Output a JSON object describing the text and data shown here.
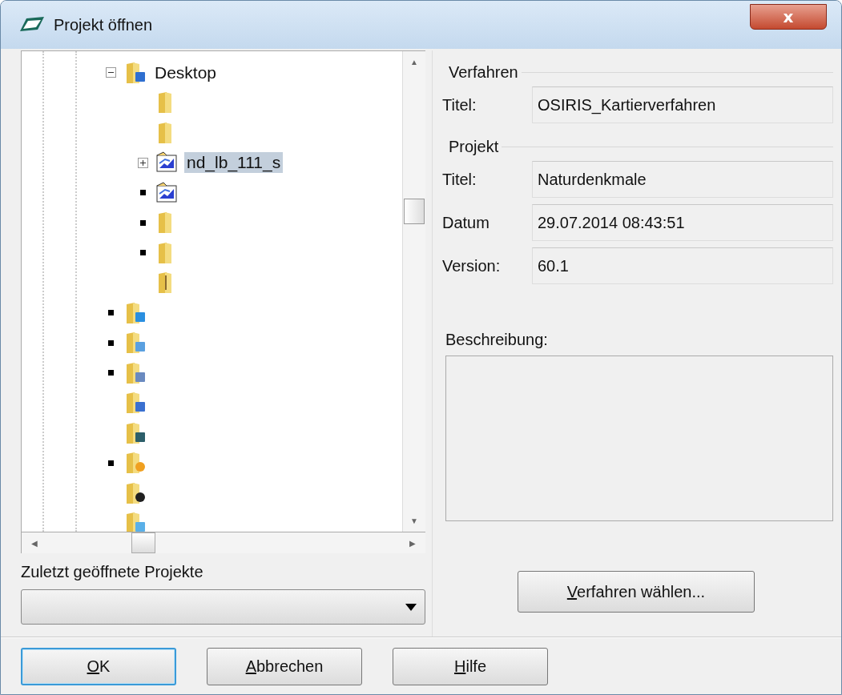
{
  "window": {
    "title": "Projekt öffnen",
    "close": "x"
  },
  "tree": {
    "items": [
      {
        "kind": "desktop",
        "label": "Desktop",
        "expanded": true,
        "selected": false,
        "children": [
          {
            "kind": "folder",
            "selected": false
          },
          {
            "kind": "folder",
            "selected": false
          },
          {
            "kind": "map",
            "label": "nd_lb_111_s",
            "expanded": false,
            "selected": true
          },
          {
            "kind": "map",
            "expanded": false,
            "selected": false
          },
          {
            "kind": "folder",
            "expanded": false,
            "selected": false
          },
          {
            "kind": "folder",
            "expanded": false,
            "selected": false
          },
          {
            "kind": "zip",
            "selected": false
          }
        ]
      },
      {
        "kind": "user",
        "expanded": false,
        "selected": false
      },
      {
        "kind": "doc",
        "expanded": false,
        "selected": false
      },
      {
        "kind": "grid",
        "expanded": false,
        "selected": false
      },
      {
        "kind": "media",
        "selected": false
      },
      {
        "kind": "film",
        "selected": false
      },
      {
        "kind": "star",
        "expanded": false,
        "selected": false
      },
      {
        "kind": "dark",
        "selected": false
      },
      {
        "kind": "image",
        "selected": false
      }
    ],
    "scroll": {
      "up": "▲",
      "down": "▼",
      "left": "◀",
      "right": "▶"
    }
  },
  "recent": {
    "label": "Zuletzt geöffnete Projekte"
  },
  "verfahren": {
    "heading": "Verfahren",
    "fields": [
      {
        "label": "Titel:",
        "value": "OSIRIS_Kartierverfahren"
      }
    ]
  },
  "projekt": {
    "heading": "Projekt",
    "fields": [
      {
        "label": "Titel:",
        "value": "Naturdenkmale"
      },
      {
        "label": "Datum",
        "value": "29.07.2014 08:43:51"
      },
      {
        "label": "Version:",
        "value": "60.1"
      }
    ]
  },
  "beschreibung": {
    "label": "Beschreibung:"
  },
  "choose_button": "Verfahren wählen...",
  "buttons": [
    {
      "label": "OK",
      "default": true
    },
    {
      "label": "Abbrechen",
      "default": false
    },
    {
      "label": "Hilfe",
      "default": false
    }
  ]
}
